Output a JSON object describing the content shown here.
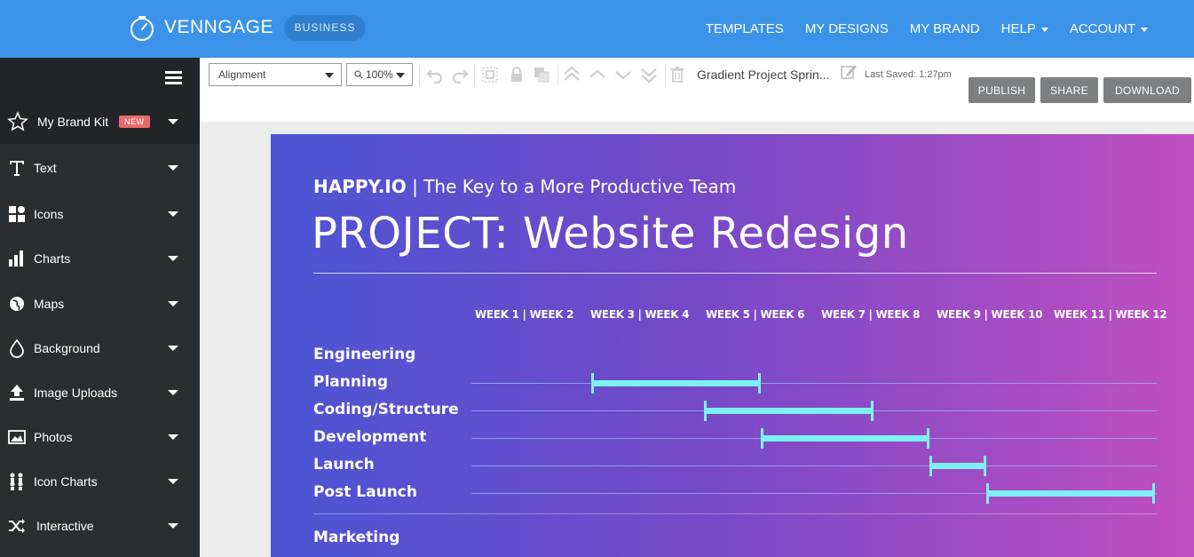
{
  "topbar": {
    "brand": "VENNGAGE",
    "plan": "BUSINESS",
    "nav": [
      {
        "label": "TEMPLATES",
        "dropdown": false
      },
      {
        "label": "MY DESIGNS",
        "dropdown": false
      },
      {
        "label": "MY BRAND",
        "dropdown": false
      },
      {
        "label": "HELP",
        "dropdown": true
      },
      {
        "label": "ACCOUNT",
        "dropdown": true
      }
    ]
  },
  "sidebar": {
    "items": [
      {
        "label": "My Brand Kit",
        "icon": "star-icon",
        "badge": "NEW"
      },
      {
        "label": "Text",
        "icon": "text-icon"
      },
      {
        "label": "Icons",
        "icon": "shapes-icon"
      },
      {
        "label": "Charts",
        "icon": "bar-chart-icon"
      },
      {
        "label": "Maps",
        "icon": "globe-icon"
      },
      {
        "label": "Background",
        "icon": "droplet-icon"
      },
      {
        "label": "Image Uploads",
        "icon": "upload-icon"
      },
      {
        "label": "Photos",
        "icon": "photo-icon"
      },
      {
        "label": "Icon Charts",
        "icon": "people-chart-icon"
      },
      {
        "label": "Interactive",
        "icon": "shuffle-icon"
      }
    ]
  },
  "toolbar": {
    "alignment": "Alignment",
    "zoom": "100%",
    "doc_title": "Gradient Project Sprin...",
    "last_saved": "Last Saved: 1:27pm",
    "publish": "PUBLISH",
    "share": "SHARE",
    "download": "DOWNLOAD"
  },
  "infographic": {
    "brand": "HAPPY.IO",
    "tagline": "| The Key to a More Productive Team",
    "title": "PROJECT: Website Redesign",
    "weeks": [
      "WEEK 1 | WEEK 2",
      "WEEK 3 | WEEK 4",
      "WEEK 5 | WEEK 6",
      "WEEK 7 | WEEK 8",
      "WEEK 9 | WEEK 10",
      "WEEK 11 | WEEK 12"
    ],
    "sections": [
      {
        "name": "Engineering",
        "tasks": [
          {
            "name": "Planning",
            "start": 3,
            "end": 6
          },
          {
            "name": "Coding/Structure",
            "start": 5,
            "end": 8
          },
          {
            "name": "Development",
            "start": 6,
            "end": 9
          },
          {
            "name": "Launch",
            "start": 9,
            "end": 10
          },
          {
            "name": "Post Launch",
            "start": 10,
            "end": 13
          }
        ]
      },
      {
        "name": "Marketing",
        "tasks": []
      }
    ],
    "bar_color": "#7df0f5"
  }
}
